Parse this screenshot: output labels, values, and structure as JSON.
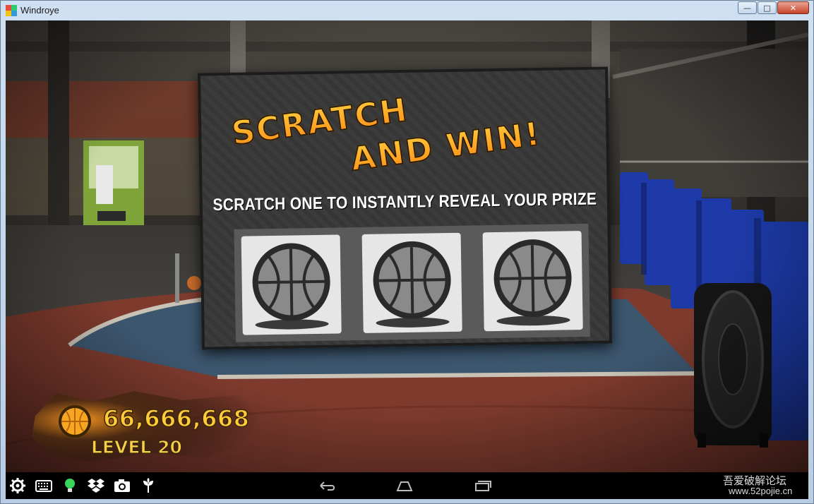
{
  "window": {
    "title": "Windroye",
    "buttons": [
      "minimize",
      "maximize",
      "close"
    ]
  },
  "card": {
    "title_line1": "SCRATCH",
    "title_line2": "AND WIN!",
    "subtitle": "SCRATCH ONE TO INSTANTLY REVEAL YOUR PRIZE",
    "tiles": [
      {
        "icon": "basketball-icon"
      },
      {
        "icon": "basketball-icon"
      },
      {
        "icon": "basketball-icon"
      }
    ]
  },
  "hud": {
    "coins": "66,666,668",
    "level": "LEVEL 20"
  },
  "navbar": {
    "tools": [
      "settings-icon",
      "keyboard-icon",
      "bulb-icon",
      "dropbox-icon",
      "camera-icon",
      "plant-icon"
    ],
    "nav": [
      "back-icon",
      "home-icon",
      "recents-icon"
    ]
  },
  "watermark": {
    "line1": "吾爱破解论坛",
    "line2": "www.52pojie.cn"
  },
  "colors": {
    "title_gradient_top": "#ffcf3d",
    "title_gradient_bottom": "#ff8a14",
    "coin_text": "#ffcb38",
    "court_red": "#8a3b2e",
    "court_blue": "#3e5a73",
    "bleacher_blue": "#1d3aa8"
  }
}
